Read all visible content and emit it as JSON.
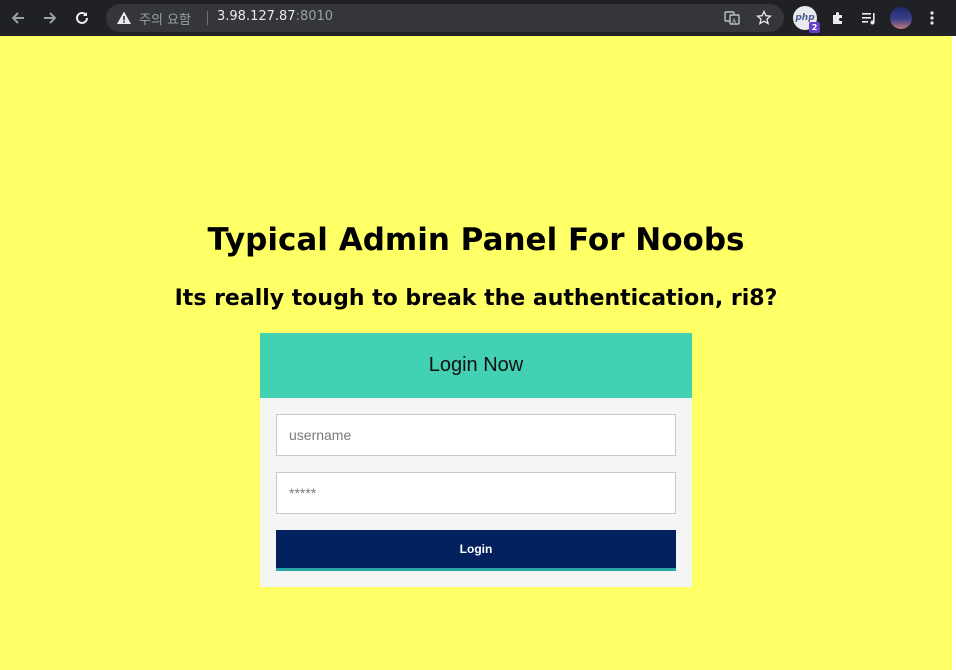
{
  "browser": {
    "security_label": "주의 요함",
    "url_host": "3.98.127.87",
    "url_port": ":8010",
    "icons": [
      "back-arrow-icon",
      "forward-arrow-icon",
      "reload-icon",
      "warning-icon",
      "translate-icon",
      "star-icon",
      "php-extension-icon",
      "puzzle-icon",
      "media-queue-icon",
      "profile-avatar",
      "kebab-menu-icon"
    ],
    "php_badge_text": "php",
    "php_badge_count": "2"
  },
  "page": {
    "title": "Typical Admin Panel For Noobs",
    "subtitle": "Its really tough to break the authentication, ri8?",
    "background_color": "#ffff66"
  },
  "login": {
    "header": "Login Now",
    "username_placeholder": "username",
    "password_placeholder": "*****",
    "button_label": "Login",
    "header_color": "#43d1b3",
    "button_color": "#03215d"
  }
}
